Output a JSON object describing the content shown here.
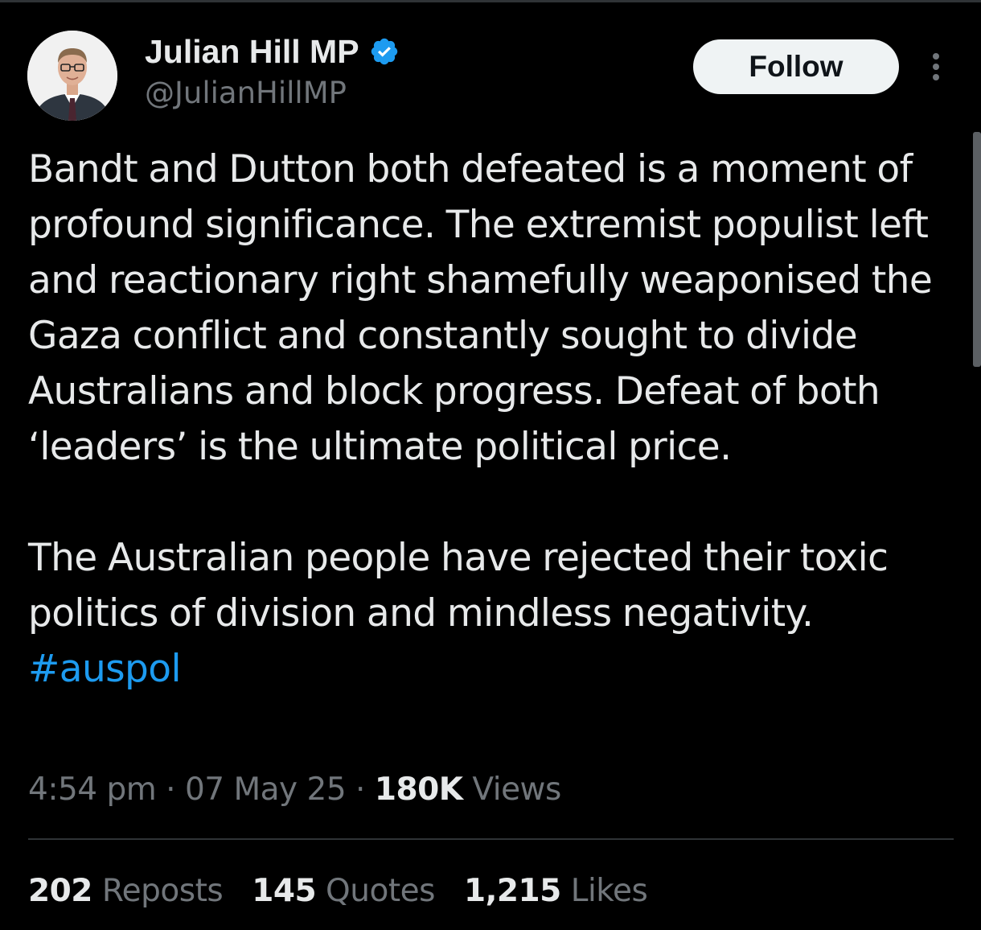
{
  "author": {
    "display_name": "Julian Hill MP",
    "handle": "@JulianHillMP",
    "verified_icon": "verified-badge-icon"
  },
  "follow_button": {
    "label": "Follow"
  },
  "tweet": {
    "paragraph_1": "Bandt and Dutton both defeated is a moment of profound significance. The extremist populist left and reactionary right shamefully weaponised the Gaza conflict and constantly sought to divide Australians and block progress. Defeat of both ‘leaders’ is the ultimate political price.",
    "paragraph_2": "The Australian people have rejected their toxic politics of division and mindless negativity.",
    "hashtag": "#auspol"
  },
  "meta": {
    "time": "4:54 pm",
    "separator": "·",
    "date": "07 May 25",
    "views_count": "180K",
    "views_label": "Views"
  },
  "stats": {
    "reposts": {
      "count": "202",
      "label": "Reposts"
    },
    "quotes": {
      "count": "145",
      "label": "Quotes"
    },
    "likes": {
      "count": "1,215",
      "label": "Likes"
    }
  },
  "colors": {
    "background": "#000000",
    "text_primary": "#e7e9ea",
    "text_secondary": "#71767b",
    "accent": "#1d9bf0",
    "follow_bg": "#eff3f4"
  }
}
